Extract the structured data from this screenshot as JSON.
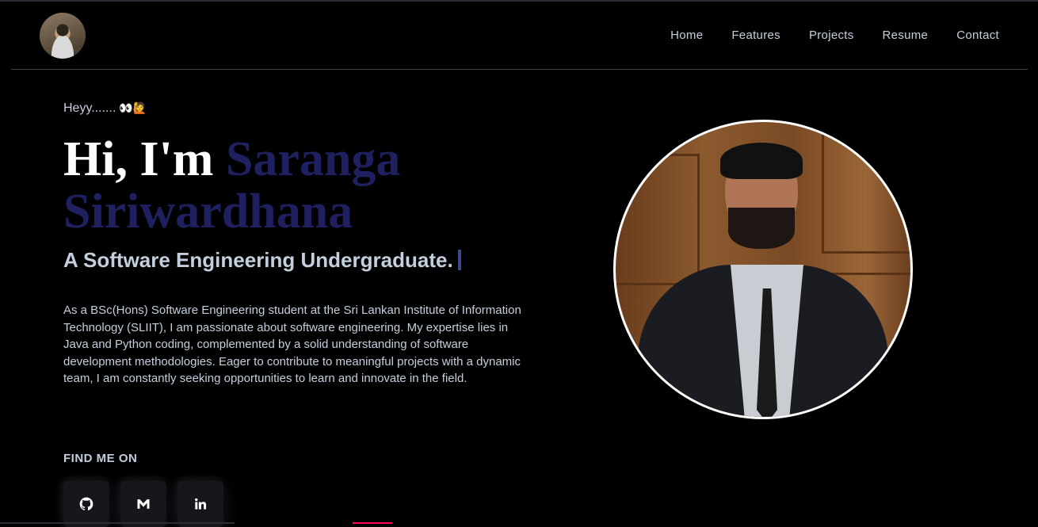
{
  "nav": {
    "items": [
      "Home",
      "Features",
      "Projects",
      "Resume",
      "Contact"
    ]
  },
  "hero": {
    "greeting": "Heyy.......",
    "greeting_emoji": "👀🙋",
    "title_prefix": "Hi, I'm ",
    "name": "Saranga Siriwardhana",
    "role": "A Software Engineering Undergraduate.",
    "bio": "As a BSc(Hons) Software Engineering student at the Sri Lankan Institute of Information Technology (SLIIT), I am passionate about software engineering. My expertise lies in Java and Python coding, complemented by a solid understanding of software development methodologies. Eager to contribute to meaningful projects with a dynamic team, I am constantly seeking opportunities to learn and innovate in the field."
  },
  "social": {
    "heading": "FIND ME ON",
    "links": [
      {
        "icon": "github-icon"
      },
      {
        "icon": "gmail-icon"
      },
      {
        "icon": "linkedin-icon"
      }
    ]
  },
  "colors": {
    "background": "#000000",
    "text": "#c4cfde",
    "name_accent": "#1e2060",
    "cursor": "#3d4a8a"
  }
}
